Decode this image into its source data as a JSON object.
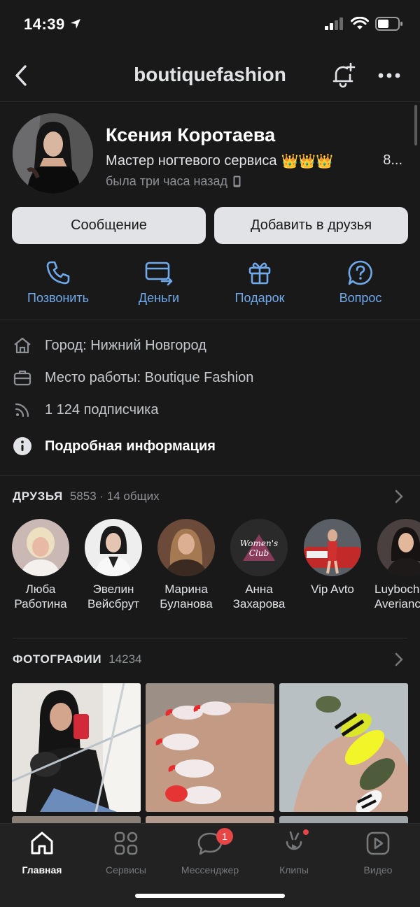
{
  "status_bar": {
    "time": "14:39",
    "icons": [
      "location-arrow-icon",
      "signal-icon",
      "wifi-icon",
      "battery-icon"
    ]
  },
  "nav": {
    "title": "boutiquefashion",
    "icons": [
      "back-chevron-icon",
      "bell-add-icon",
      "more-dots-icon"
    ]
  },
  "profile": {
    "name": "Ксения Коротаева",
    "status": "Мастер ногтевого сервиса",
    "status_emoji": "👑👑👑",
    "status_extra": "8...",
    "last_seen": "была три часа назад",
    "last_seen_icon": "phone-icon"
  },
  "buttons": {
    "message": "Сообщение",
    "add_friend": "Добавить в друзья"
  },
  "actions": [
    {
      "label": "Позвонить",
      "icon": "phone-call-icon"
    },
    {
      "label": "Деньги",
      "icon": "money-card-icon"
    },
    {
      "label": "Подарок",
      "icon": "gift-icon"
    },
    {
      "label": "Вопрос",
      "icon": "question-bubble-icon"
    }
  ],
  "info": {
    "city": "Город: Нижний Новгород",
    "work": "Место работы: Boutique Fashion",
    "followers": "1 124 подписчика",
    "details": "Подробная информация"
  },
  "friends": {
    "title": "ДРУЗЬЯ",
    "count": "5853 · 14 общих",
    "items": [
      {
        "line1": "Люба",
        "line2": "Работина"
      },
      {
        "line1": "Эвелин",
        "line2": "Вейсбрут"
      },
      {
        "line1": "Марина",
        "line2": "Буланова"
      },
      {
        "line1": "Анна",
        "line2": "Захарова",
        "avatar_text": "Women's Club"
      },
      {
        "line1": "Vip Avto",
        "line2": ""
      },
      {
        "line1": "Luyboch",
        "line2": "Averianc"
      }
    ]
  },
  "photos": {
    "title": "ФОТОГРАФИИ",
    "count": "14234"
  },
  "tabs": [
    {
      "label": "Главная",
      "icon": "home-icon"
    },
    {
      "label": "Сервисы",
      "icon": "grid-icon"
    },
    {
      "label": "Мессенджер",
      "icon": "chat-bubble-icon",
      "badge": "1"
    },
    {
      "label": "Клипы",
      "icon": "clips-icon"
    },
    {
      "label": "Видео",
      "icon": "video-icon"
    }
  ],
  "colors": {
    "accent": "#71aaeb",
    "background": "#19191a",
    "badge": "#e64646"
  }
}
